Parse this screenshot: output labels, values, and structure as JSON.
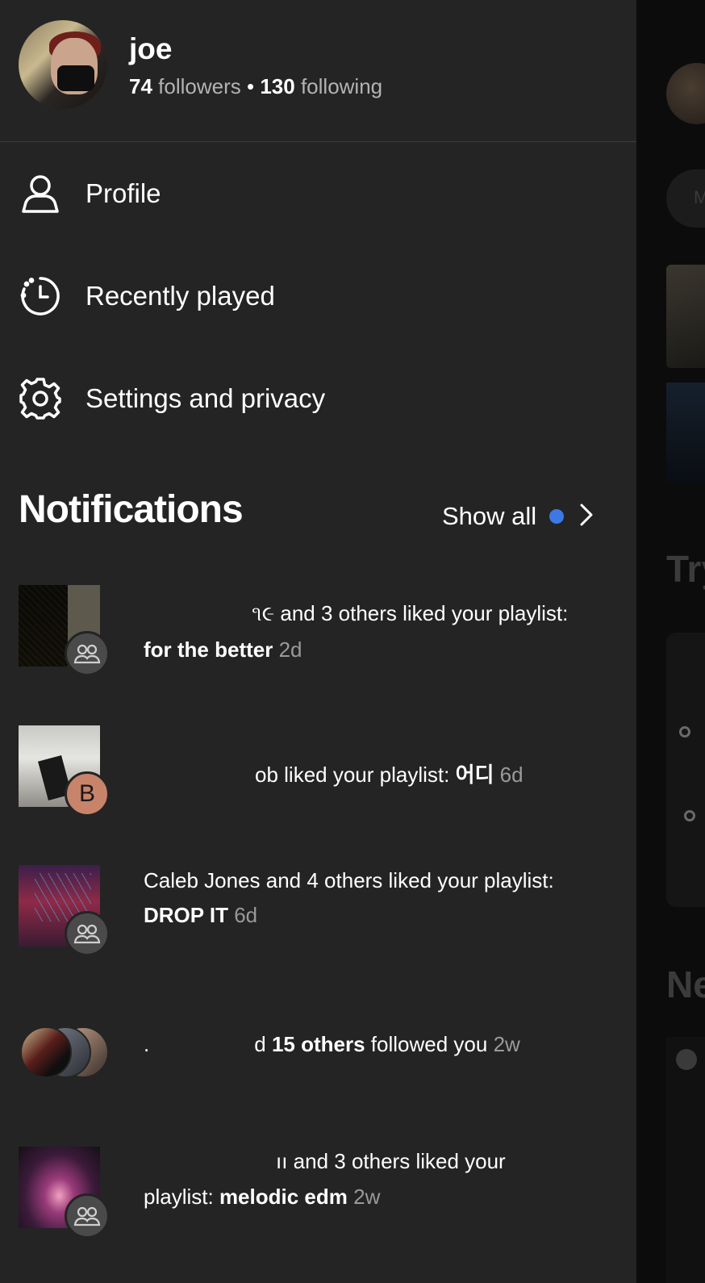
{
  "user": {
    "name": "joe",
    "followers_count": "74",
    "followers_label": "followers",
    "separator": "•",
    "following_count": "130",
    "following_label": "following"
  },
  "menu": [
    {
      "label": "Profile",
      "icon": "person-icon"
    },
    {
      "label": "Recently played",
      "icon": "history-icon"
    },
    {
      "label": "Settings and privacy",
      "icon": "gear-icon"
    }
  ],
  "notifications": {
    "title": "Notifications",
    "show_all_label": "Show all",
    "items": [
      {
        "lead": "૧૯ and 3 others liked your playlist:",
        "target": "for the better",
        "time": "2d",
        "badge": "group-icon"
      },
      {
        "lead": "ob liked your playlist:",
        "target": "어디",
        "time": "6d",
        "badge_letter": "B"
      },
      {
        "lead": "Caleb Jones and 4 others liked your playlist:",
        "target": "DROP IT",
        "time": "6d",
        "badge": "group-icon"
      },
      {
        "dot": ".",
        "lead_prefix": "d",
        "strong": "15 others",
        "lead_suffix": "followed you",
        "time": "2w"
      },
      {
        "lead": "ıı and 3 others liked your",
        "lead2": "playlist:",
        "target": "melodic edm",
        "time": "2w",
        "badge": "group-icon"
      }
    ]
  },
  "background": {
    "chip_letter": "M",
    "heading1": "Try",
    "heading2": "Ne"
  },
  "colors": {
    "drawer_bg": "#242424",
    "accent_dot": "#3d79e6",
    "muted_text": "#b3b3b3"
  }
}
